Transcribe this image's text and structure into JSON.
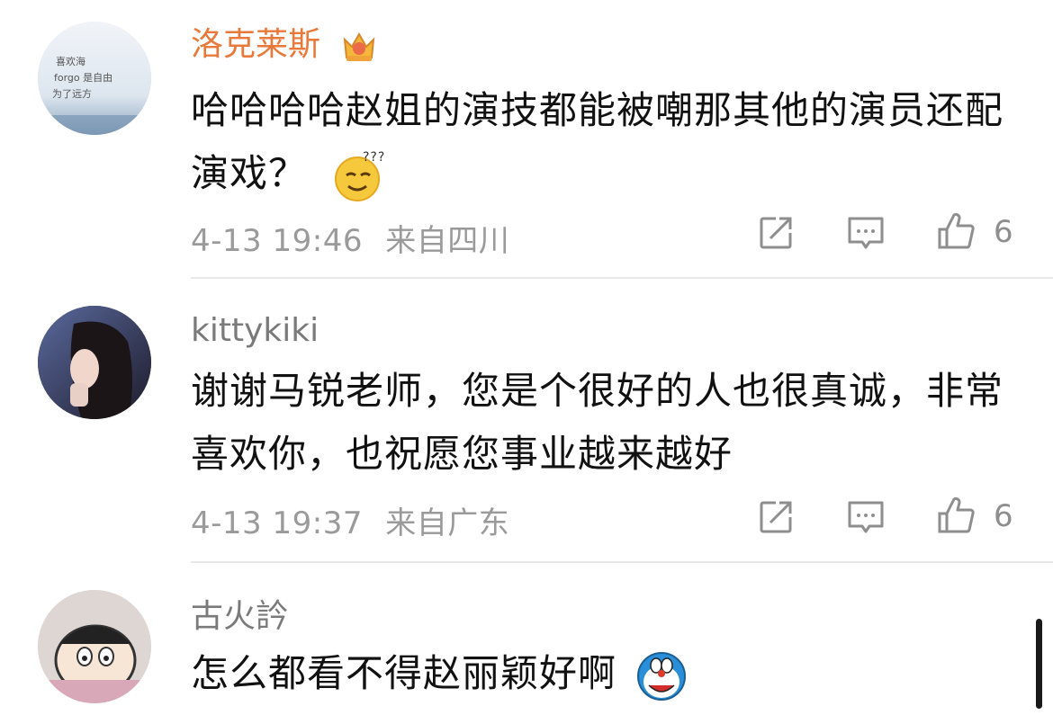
{
  "comments": [
    {
      "username": "洛克莱斯",
      "username_color": "#e8793a",
      "badge_icon": "crown-vip-icon",
      "avatar_text": [
        "喜欢海",
        "forgo 是自由",
        "为了远方"
      ],
      "text": "哈哈哈哈赵姐的演技都能被嘲那其他的演员还配演戏？",
      "trailing_emoji": "thinking-confused-emoji",
      "time": "4-13 19:46",
      "location": "来自四川",
      "likes": "6"
    },
    {
      "username": "kittykiki",
      "username_color": "#7a7a7a",
      "text": "谢谢马锐老师，您是个很好的人也很真诚，非常喜欢你，也祝愿您事业越来越好",
      "time": "4-13 19:37",
      "location": "来自广东",
      "likes": "6"
    },
    {
      "username": "古火訡",
      "username_color": "#7a7a7a",
      "text": "怎么都看不得赵丽颖好啊",
      "trailing_emoji": "doraemon-emoji",
      "time": "",
      "location": "",
      "likes": ""
    }
  ],
  "actions": {
    "share_icon": "share-icon",
    "comment_icon": "comment-icon",
    "like_icon": "thumbs-up-icon"
  }
}
